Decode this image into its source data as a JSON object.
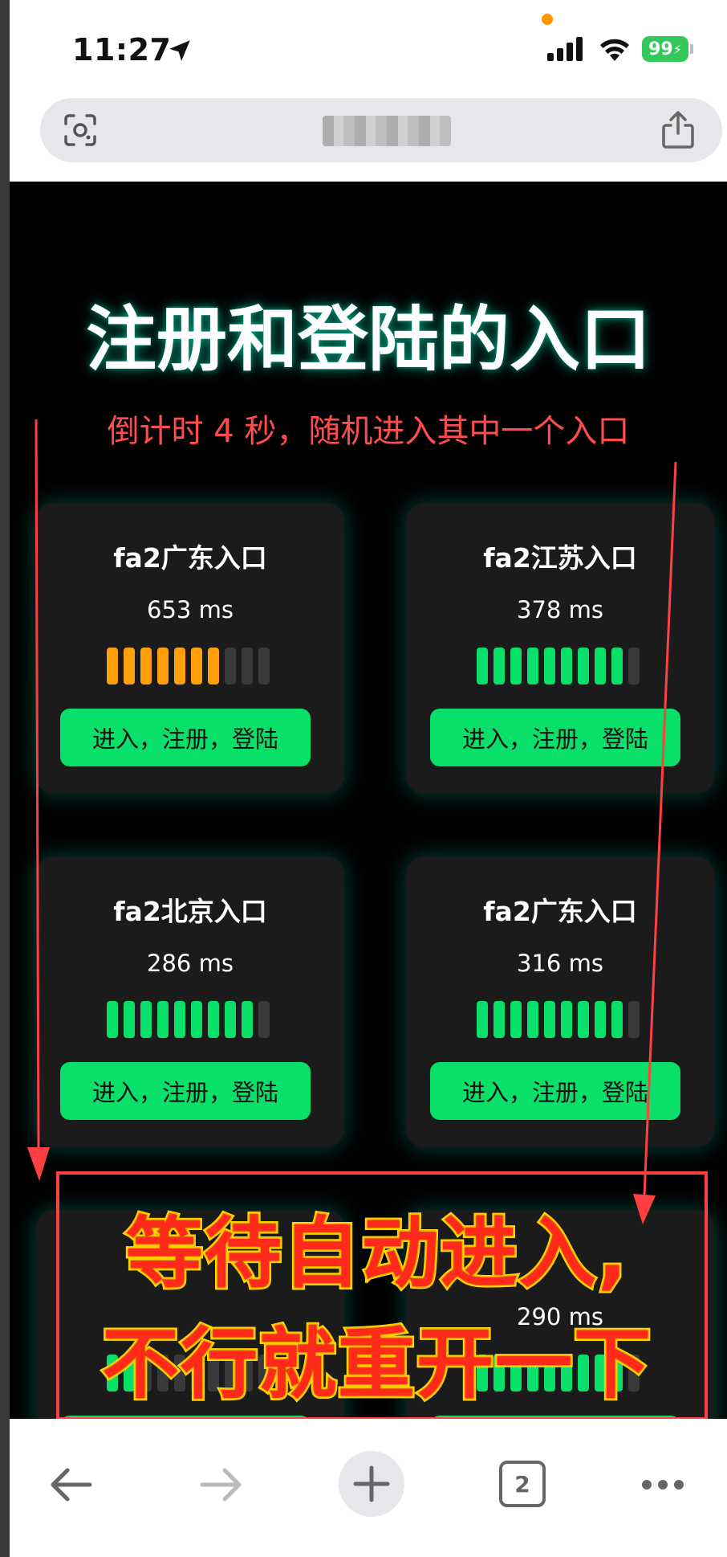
{
  "status_bar": {
    "time": "11:27",
    "battery": "99"
  },
  "address_bar": {
    "url": ""
  },
  "page": {
    "title": "注册和登陆的入口",
    "countdown": "倒计时 4 秒，随机进入其中一个入口",
    "entries": [
      {
        "name": "fa2广东入口",
        "latency": "653 ms",
        "signal_bars": 7,
        "total_bars": 10,
        "quality": "orange",
        "button": "进入，注册，登陆"
      },
      {
        "name": "fa2江苏入口",
        "latency": "378 ms",
        "signal_bars": 9,
        "total_bars": 10,
        "quality": "green",
        "button": "进入，注册，登陆"
      },
      {
        "name": "fa2北京入口",
        "latency": "286 ms",
        "signal_bars": 9,
        "total_bars": 10,
        "quality": "green",
        "button": "进入，注册，登陆"
      },
      {
        "name": "fa2广东入口",
        "latency": "316 ms",
        "signal_bars": 9,
        "total_bars": 10,
        "quality": "green",
        "button": "进入，注册，登陆"
      },
      {
        "name": "",
        "latency": "",
        "signal_bars": 2,
        "total_bars": 10,
        "quality": "green",
        "button": ""
      },
      {
        "name": "",
        "latency": "290 ms",
        "signal_bars": 9,
        "total_bars": 10,
        "quality": "green",
        "button": ""
      }
    ]
  },
  "overlay": {
    "line1": "等待自动进入,",
    "line2": "不行就重开一下"
  },
  "toolbar": {
    "tab_count": "2"
  },
  "colors": {
    "good": "#08e06a",
    "warn": "#ff9f0a",
    "countdown": "#ff4d4d",
    "annotation": "#ff4040"
  }
}
